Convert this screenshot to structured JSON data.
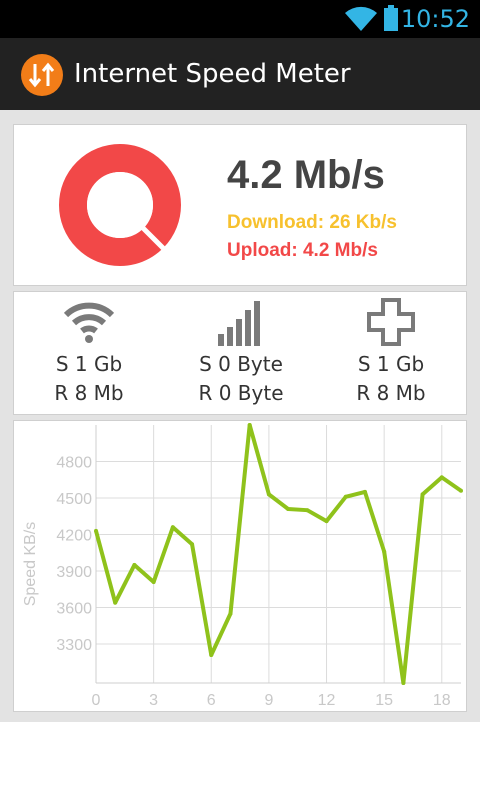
{
  "status_bar": {
    "time": "10:52",
    "icons": [
      "wifi-icon",
      "battery-icon"
    ],
    "color": "#33b5e5"
  },
  "action_bar": {
    "title": "Internet Speed Meter",
    "icon": "up-down-arrows-icon",
    "icon_color": "#f27d18"
  },
  "speed_card": {
    "total_speed": "4.2 Mb/s",
    "download": "Download: 26 Kb/s",
    "upload": "Upload: 4.2 Mb/s",
    "colors": {
      "download": "#f7c12e",
      "upload": "#f24848",
      "ring": "#f24848"
    }
  },
  "stats": [
    {
      "icon": "wifi-icon",
      "sent": "S 1 Gb",
      "received": "R 8 Mb"
    },
    {
      "icon": "mobile-signal-icon",
      "sent": "S 0 Byte",
      "received": "R 0 Byte"
    },
    {
      "icon": "plus-icon",
      "sent": "S 1 Gb",
      "received": "R 8 Mb"
    }
  ],
  "chart_data": {
    "type": "line",
    "ylabel": "Speed KB/s",
    "xlabel": "",
    "y_ticks": [
      "3300",
      "3600",
      "3900",
      "4200",
      "4500",
      "4800"
    ],
    "x_ticks": [
      "0",
      "3",
      "6",
      "9",
      "12",
      "15",
      "18"
    ],
    "xlim": [
      0,
      19
    ],
    "ylim": [
      2980,
      5100
    ],
    "grid": true,
    "color": "#8fc21b",
    "series": [
      {
        "x": [
          0,
          1,
          2,
          3,
          4,
          5,
          6,
          7,
          8,
          9,
          10,
          11,
          12,
          13,
          14,
          15,
          16,
          17,
          18,
          19
        ],
        "values": [
          4230,
          3640,
          3950,
          3810,
          4260,
          4120,
          3210,
          3550,
          5100,
          4530,
          4410,
          4400,
          4310,
          4510,
          4550,
          4060,
          2980,
          4530,
          4670,
          4560
        ]
      }
    ]
  }
}
